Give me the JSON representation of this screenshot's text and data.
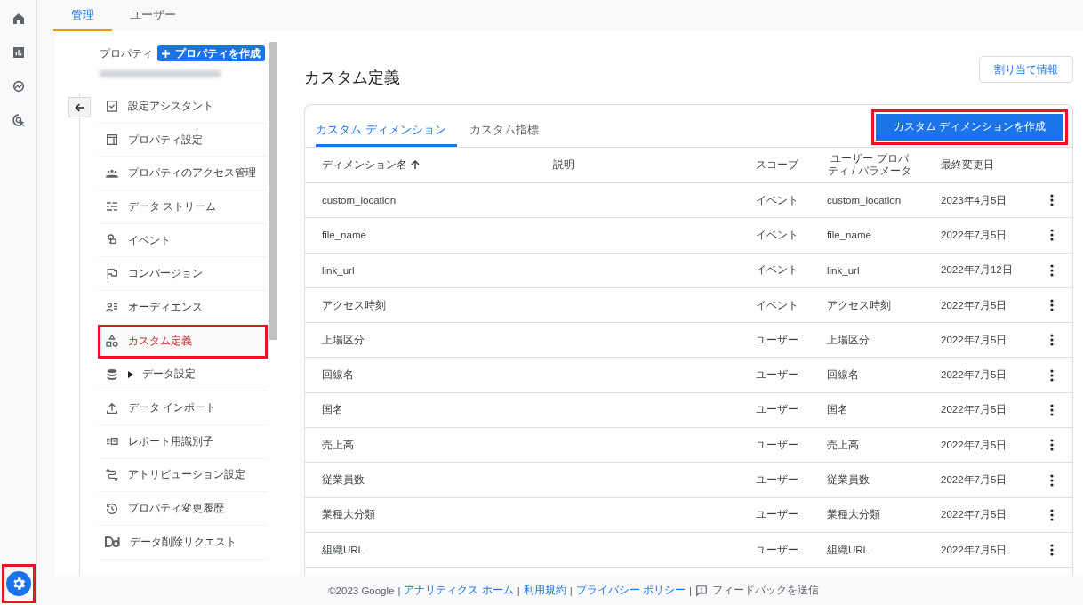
{
  "rail": [
    {
      "kind": "home",
      "selected": false
    },
    {
      "kind": "reports",
      "selected": false
    },
    {
      "kind": "explore",
      "selected": false
    },
    {
      "kind": "advertising",
      "selected": false
    }
  ],
  "settings": {
    "selected": true,
    "highlighted": true
  },
  "top_tabs": [
    {
      "label": "管理",
      "selected": true
    },
    {
      "label": "ユーザー",
      "selected": false
    }
  ],
  "property": {
    "label": "プロパティ",
    "create_button": "プロパティを作成"
  },
  "nav": [
    {
      "kind": "checklist",
      "label": "設定アシスタント",
      "selected": false,
      "highlighted": false
    },
    {
      "kind": "layout",
      "label": "プロパティ設定",
      "selected": false,
      "highlighted": false
    },
    {
      "kind": "people",
      "label": "プロパティのアクセス管理",
      "selected": false,
      "highlighted": false
    },
    {
      "kind": "stream",
      "label": "データ ストリーム",
      "selected": false,
      "highlighted": false
    },
    {
      "kind": "touch",
      "label": "イベント",
      "selected": false,
      "highlighted": false
    },
    {
      "kind": "flag",
      "label": "コンバージョン",
      "selected": false,
      "highlighted": false
    },
    {
      "kind": "audience",
      "label": "オーディエンス",
      "selected": false,
      "highlighted": false
    },
    {
      "kind": "shapes",
      "label": "カスタム定義",
      "selected": true,
      "highlighted": true
    },
    {
      "kind": "database",
      "label": "データ設定",
      "selected": false,
      "highlighted": false,
      "expandable": true
    },
    {
      "kind": "upload",
      "label": "データ インポート",
      "selected": false,
      "highlighted": false
    },
    {
      "kind": "identity",
      "label": "レポート用識別子",
      "selected": false,
      "highlighted": false
    },
    {
      "kind": "attribution",
      "label": "アトリビューション設定",
      "selected": false,
      "highlighted": false
    },
    {
      "kind": "history",
      "label": "プロパティ変更履歴",
      "selected": false,
      "highlighted": false
    },
    {
      "kind": "dd",
      "label": "データ削除リクエスト",
      "selected": false,
      "highlighted": false
    }
  ],
  "page_title": "カスタム定義",
  "assign_button": "割り当て情報",
  "card_tabs": [
    {
      "label": "カスタム ディメンション",
      "selected": true
    },
    {
      "label": "カスタム指標",
      "selected": false
    }
  ],
  "create_button": {
    "label": "カスタム ディメンションを作成",
    "highlighted": true
  },
  "table": {
    "columns": [
      "ディメンション名",
      "説明",
      "スコープ",
      "ユーザー プロパティ / パラメータ",
      "最終変更日"
    ],
    "rows": [
      [
        "custom_location",
        "",
        "イベント",
        "custom_location",
        "2023年4月5日"
      ],
      [
        "file_name",
        "",
        "イベント",
        "file_name",
        "2022年7月5日"
      ],
      [
        "link_url",
        "",
        "イベント",
        "link_url",
        "2022年7月12日"
      ],
      [
        "アクセス時刻",
        "",
        "イベント",
        "アクセス時刻",
        "2022年7月5日"
      ],
      [
        "上場区分",
        "",
        "ユーザー",
        "上場区分",
        "2022年7月5日"
      ],
      [
        "回線名",
        "",
        "ユーザー",
        "回線名",
        "2022年7月5日"
      ],
      [
        "国名",
        "",
        "ユーザー",
        "国名",
        "2022年7月5日"
      ],
      [
        "売上高",
        "",
        "ユーザー",
        "売上高",
        "2022年7月5日"
      ],
      [
        "従業員数",
        "",
        "ユーザー",
        "従業員数",
        "2022年7月5日"
      ],
      [
        "業種大分類",
        "",
        "ユーザー",
        "業種大分類",
        "2022年7月5日"
      ],
      [
        "組織URL",
        "",
        "ユーザー",
        "組織URL",
        "2022年7月5日"
      ]
    ]
  },
  "footer": [
    {
      "kind": "text",
      "label": "©2023 Google"
    },
    {
      "kind": "separator",
      "label": "|"
    },
    {
      "kind": "link",
      "label": "アナリティクス ホーム"
    },
    {
      "kind": "separator",
      "label": "|"
    },
    {
      "kind": "link",
      "label": "利用規約"
    },
    {
      "kind": "separator",
      "label": "|"
    },
    {
      "kind": "link",
      "label": "プライバシー ポリシー"
    },
    {
      "kind": "separator",
      "label": "|"
    },
    {
      "kind": "feedback",
      "label": "フィードバックを送信"
    }
  ]
}
